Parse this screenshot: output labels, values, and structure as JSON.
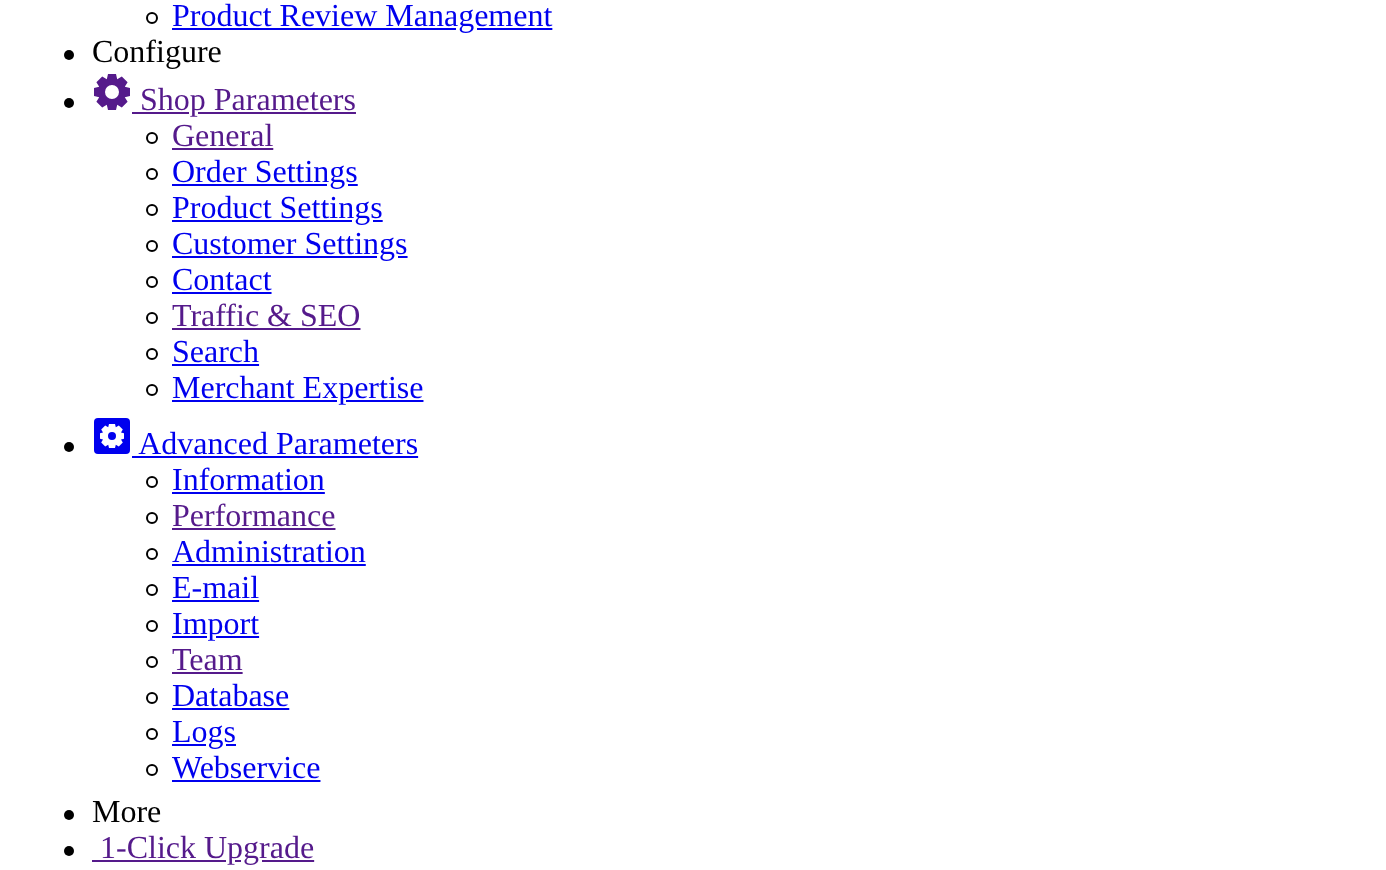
{
  "menu": [
    {
      "kind": "continuation",
      "children": [
        {
          "label": "Product Review Management",
          "visited": false
        }
      ]
    },
    {
      "kind": "heading",
      "label": "Configure"
    },
    {
      "kind": "gear-link",
      "label": " Shop Parameters",
      "visited": true,
      "children": [
        {
          "label": "General",
          "visited": true
        },
        {
          "label": "Order Settings",
          "visited": false
        },
        {
          "label": "Product Settings",
          "visited": false
        },
        {
          "label": "Customer Settings",
          "visited": false
        },
        {
          "label": "Contact",
          "visited": false
        },
        {
          "label": "Traffic & SEO",
          "visited": true
        },
        {
          "label": "Search",
          "visited": false
        },
        {
          "label": "Merchant Expertise",
          "visited": false
        }
      ]
    },
    {
      "kind": "square-gear-link",
      "label": " Advanced Parameters",
      "visited": false,
      "children": [
        {
          "label": "Information",
          "visited": false
        },
        {
          "label": "Performance",
          "visited": true
        },
        {
          "label": "Administration",
          "visited": false
        },
        {
          "label": "E-mail",
          "visited": false
        },
        {
          "label": "Import",
          "visited": false
        },
        {
          "label": "Team",
          "visited": true
        },
        {
          "label": "Database",
          "visited": false
        },
        {
          "label": "Logs",
          "visited": false
        },
        {
          "label": "Webservice",
          "visited": false
        }
      ]
    },
    {
      "kind": "heading",
      "label": "More"
    },
    {
      "kind": "link",
      "label": " 1-Click Upgrade",
      "visited": true
    }
  ]
}
